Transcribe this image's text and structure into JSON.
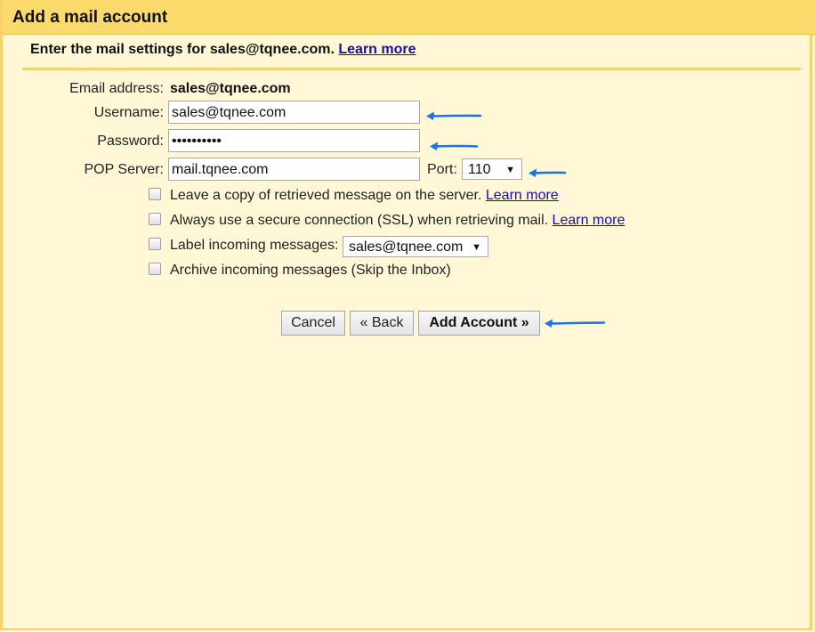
{
  "dialog": {
    "title": "Add a mail account",
    "header_text": "Enter the mail settings for sales@tqnee.com.",
    "header_link": "Learn more"
  },
  "form": {
    "email_label": "Email address:",
    "email_value": "sales@tqnee.com",
    "username_label": "Username:",
    "username_value": "sales@tqnee.com",
    "password_label": "Password:",
    "password_value": "••••••••••",
    "pop_label": "POP Server:",
    "pop_value": "mail.tqnee.com",
    "port_label": "Port:",
    "port_value": "110"
  },
  "options": [
    {
      "label": "Leave a copy of retrieved message on the server.",
      "link": "Learn more",
      "checked": false
    },
    {
      "label": "Always use a secure connection (SSL) when retrieving mail.",
      "link": "Learn more",
      "checked": false
    },
    {
      "label": "Label incoming messages:",
      "select_value": "sales@tqnee.com",
      "checked": false
    },
    {
      "label": "Archive incoming messages (Skip the Inbox)",
      "checked": false
    }
  ],
  "buttons": {
    "cancel": "Cancel",
    "back": "« Back",
    "add": "Add Account »"
  },
  "colors": {
    "background": "#fff7d6",
    "titlebar": "#fbd96a",
    "border": "#f6d36a",
    "link": "#1a0dab",
    "annotation_arrow": "#1a73e8"
  },
  "icons": {
    "annotation": "arrow-left-icon",
    "dropdown": "triangle-down-icon"
  }
}
